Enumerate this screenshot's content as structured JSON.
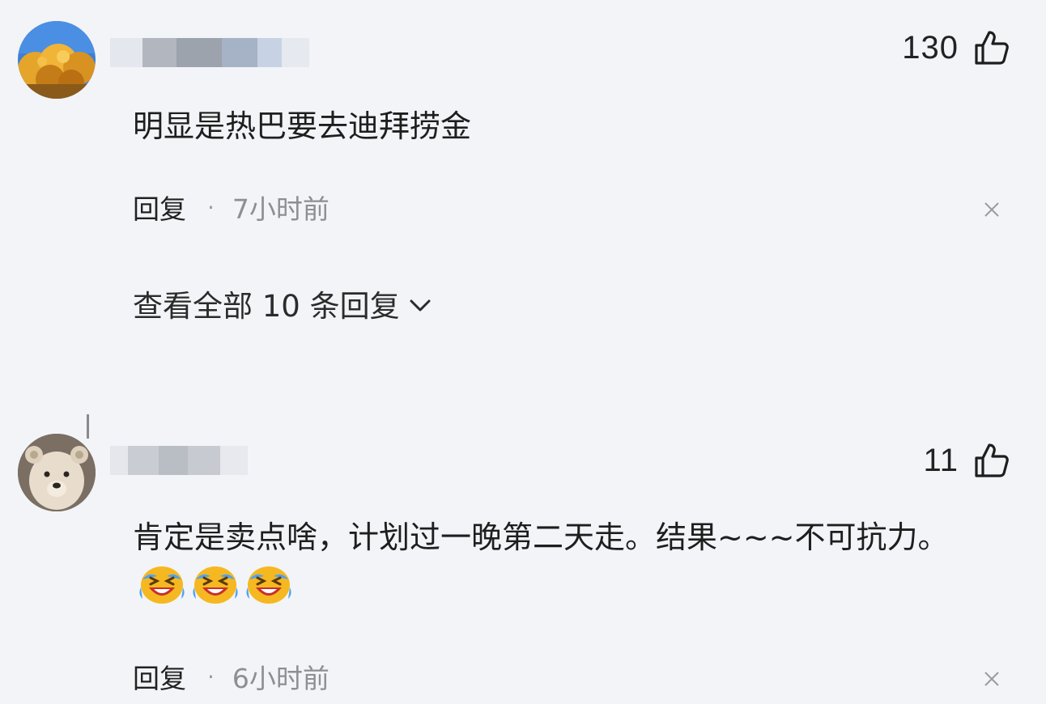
{
  "comments": [
    {
      "like_count": "130",
      "text": "明显是热巴要去迪拜捞金",
      "reply_label": "回复",
      "separator": "·",
      "time": "7小时前",
      "avatar": "autumn-tree-photo"
    },
    {
      "like_count": "11",
      "text": "肯定是卖点啥，计划过一晚第二天走。结果~~~不可抗力。",
      "reply_label": "回复",
      "separator": "·",
      "time": "6小时前",
      "avatar": "bear-photo"
    }
  ],
  "thread": {
    "view_all_label": "查看全部 10 条回复"
  },
  "icons": {
    "like": "thumbs-up-icon",
    "close": "close-icon",
    "expand": "chevron-down-icon",
    "emoji": "laughing-crying-emoji"
  },
  "colors": {
    "background": "#f3f4f8",
    "text": "#1e1e1e",
    "muted": "#8e8e93",
    "emoji": "#f6b820"
  }
}
